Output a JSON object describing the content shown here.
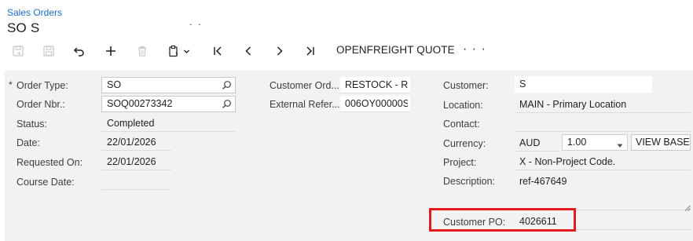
{
  "header": {
    "breadcrumb": "Sales Orders",
    "title": "SO S",
    "title_tail": ". ."
  },
  "toolbar": {
    "icons": [
      "save-close-icon",
      "save-icon",
      "undo-icon",
      "add-icon",
      "delete-icon",
      "copy-paste-icon",
      "chevron-down-icon",
      "first-record-icon",
      "previous-record-icon",
      "next-record-icon",
      "last-record-icon"
    ],
    "openfreight_label": "OPENFREIGHT QUOTE",
    "more_label": "· · ·"
  },
  "form": {
    "order_type": {
      "required_mark": "*",
      "label": "Order Type:",
      "value": "SO"
    },
    "order_nbr": {
      "label": "Order Nbr.:",
      "value": "SOQ00273342"
    },
    "status": {
      "label": "Status:",
      "value": "Completed"
    },
    "date": {
      "label": "Date:",
      "value": "22/01/2026"
    },
    "requested_on": {
      "label": "Requested On:",
      "value": "22/01/2026"
    },
    "course_date": {
      "label": "Course Date:",
      "value": ""
    },
    "customer_order": {
      "label": "Customer Ord...",
      "value": "RESTOCK - RI"
    },
    "external_reference": {
      "label": "External Refer...",
      "value": "006OY00000S"
    },
    "customer": {
      "label": "Customer:",
      "value": "S"
    },
    "location": {
      "label": "Location:",
      "value": "MAIN - Primary Location"
    },
    "contact": {
      "label": "Contact:",
      "value": ""
    },
    "currency": {
      "label": "Currency:",
      "code": "AUD",
      "rate": "1.00",
      "view_base_label": "VIEW BASE"
    },
    "project": {
      "label": "Project:",
      "value": "X - Non-Project Code."
    },
    "description": {
      "label": "Description:",
      "value": "ref-467649"
    },
    "customer_po": {
      "label": "Customer PO:",
      "value": "4026611"
    }
  },
  "colors": {
    "link": "#1a6fc9",
    "form_background": "#f2f2f2",
    "highlight": "#e31b1b"
  }
}
